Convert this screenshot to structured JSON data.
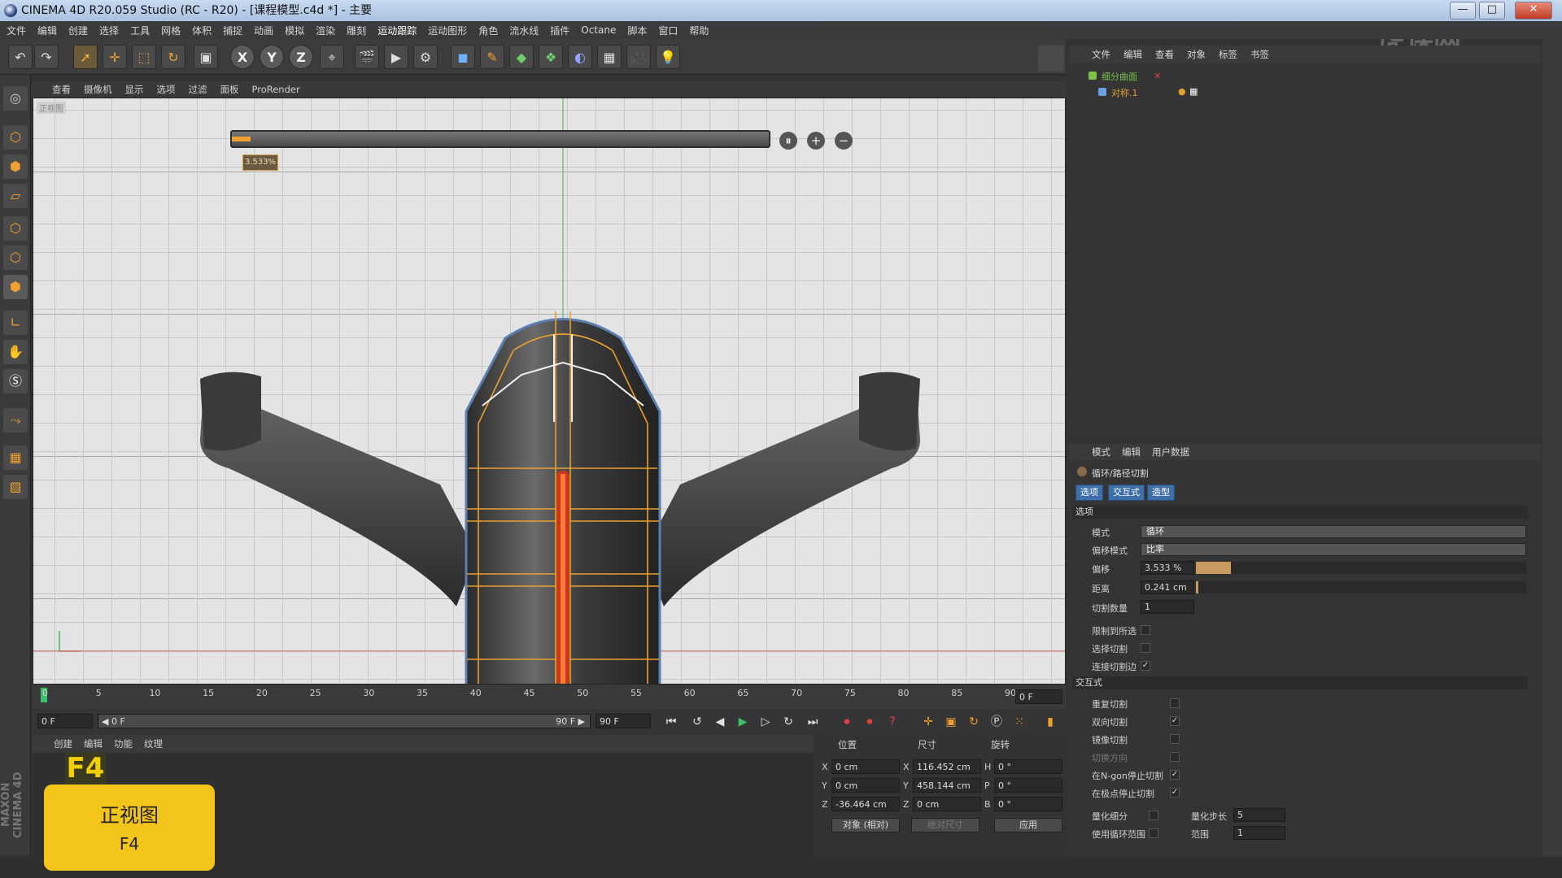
{
  "window": {
    "title": "CINEMA 4D R20.059 Studio (RC - R20) - [课程模型.c4d *] - 主要",
    "minimize": "—",
    "maximize": "□",
    "close": "✕"
  },
  "menubar": [
    "文件",
    "编辑",
    "创建",
    "选择",
    "工具",
    "网格",
    "体积",
    "捕捉",
    "动画",
    "模拟",
    "渲染",
    "雕刻",
    "运动跟踪",
    "运动图形",
    "角色",
    "流水线",
    "插件",
    "Octane",
    "脚本",
    "窗口",
    "帮助"
  ],
  "toolbar": {
    "undo": "↶",
    "move": "✛",
    "scale": "⬚",
    "rotate": "↻",
    "axis_x": "X",
    "axis_y": "Y",
    "axis_z": "Z"
  },
  "viewport": {
    "menu": [
      "查看",
      "摄像机",
      "显示",
      "选项",
      "过滤",
      "面板",
      "ProRender"
    ],
    "label": "正视图",
    "slider_pct": "3.533%",
    "slider_value": 0.03533,
    "btn_pause": "⏸",
    "btn_add": "+",
    "btn_minus": "−"
  },
  "timeline": {
    "ticks": [
      "0",
      "5",
      "10",
      "15",
      "20",
      "25",
      "30",
      "35",
      "40",
      "45",
      "50",
      "55",
      "60",
      "65",
      "70",
      "75",
      "80",
      "85",
      "90"
    ],
    "end_field": "0 F",
    "start_field": "0 F",
    "range_start": "◀ 0 F",
    "range_end": "90 F ▶",
    "max_field": "90 F"
  },
  "material": {
    "menu": [
      "创建",
      "编辑",
      "功能",
      "纹理"
    ]
  },
  "coords": {
    "headers": [
      "位置",
      "尺寸",
      "旋转"
    ],
    "rows": [
      {
        "axis": "X",
        "pos": "0 cm",
        "size_axis": "X",
        "size": "116.452 cm",
        "rot_axis": "H",
        "rot": "0 °"
      },
      {
        "axis": "Y",
        "pos": "0 cm",
        "size_axis": "Y",
        "size": "458.144 cm",
        "rot_axis": "P",
        "rot": "0 °"
      },
      {
        "axis": "Z",
        "pos": "-36.464 cm",
        "size_axis": "Z",
        "size": "0 cm",
        "rot_axis": "B",
        "rot": "0 °"
      }
    ],
    "mode": "对象 (相对)",
    "size_mode": "绝对尺寸",
    "apply": "应用"
  },
  "objects": {
    "menu": [
      "文件",
      "编辑",
      "查看",
      "对象",
      "标签",
      "书签"
    ],
    "items": [
      {
        "name": "细分曲面",
        "color": "#7bc24a"
      },
      {
        "name": "对称.1",
        "color": "#e0a030"
      }
    ]
  },
  "attributes": {
    "menu": [
      "模式",
      "编辑",
      "用户数据"
    ],
    "tool_title": "循环/路径切割",
    "tabs": [
      "选项",
      "交互式",
      "造型"
    ],
    "section_options": "选项",
    "mode_label": "模式",
    "mode_value": "循环",
    "offset_mode_label": "偏移模式",
    "offset_mode_value": "比率",
    "offset_label": "偏移",
    "offset_value": "3.533 %",
    "offset_fraction": 0.03533,
    "distance_label": "距离",
    "distance_value": "0.241 cm",
    "cuts_label": "切割数量",
    "cuts_value": "1",
    "checks1": [
      {
        "label": "限制到所选",
        "checked": false
      },
      {
        "label": "选择切割",
        "checked": false
      },
      {
        "label": "连接切割边",
        "checked": true
      }
    ],
    "section_interactive": "交互式",
    "checks2": [
      {
        "label": "重复切割",
        "checked": false
      },
      {
        "label": "双向切割",
        "checked": true
      },
      {
        "label": "镜像切割",
        "checked": false
      },
      {
        "label": "切换方向",
        "checked": false
      },
      {
        "label": "在N-gon停止切割",
        "checked": true
      },
      {
        "label": "在极点停止切割",
        "checked": true
      }
    ],
    "quant_label": "量化细分",
    "quant_step_label": "量化步长",
    "quant_step_value": "5",
    "use_range_label": "使用循环范围",
    "range_label": "范围",
    "range_value": "1"
  },
  "caption": {
    "tag": "F4",
    "line1": "正视图",
    "line2": "F4"
  },
  "branding": {
    "maxon": "MAXON CINEMA 4D",
    "watermark": "虎课网"
  },
  "colors": {
    "accent": "#f3c419",
    "selection": "#3f6fa8",
    "edge_highlight": "#e8a030"
  }
}
